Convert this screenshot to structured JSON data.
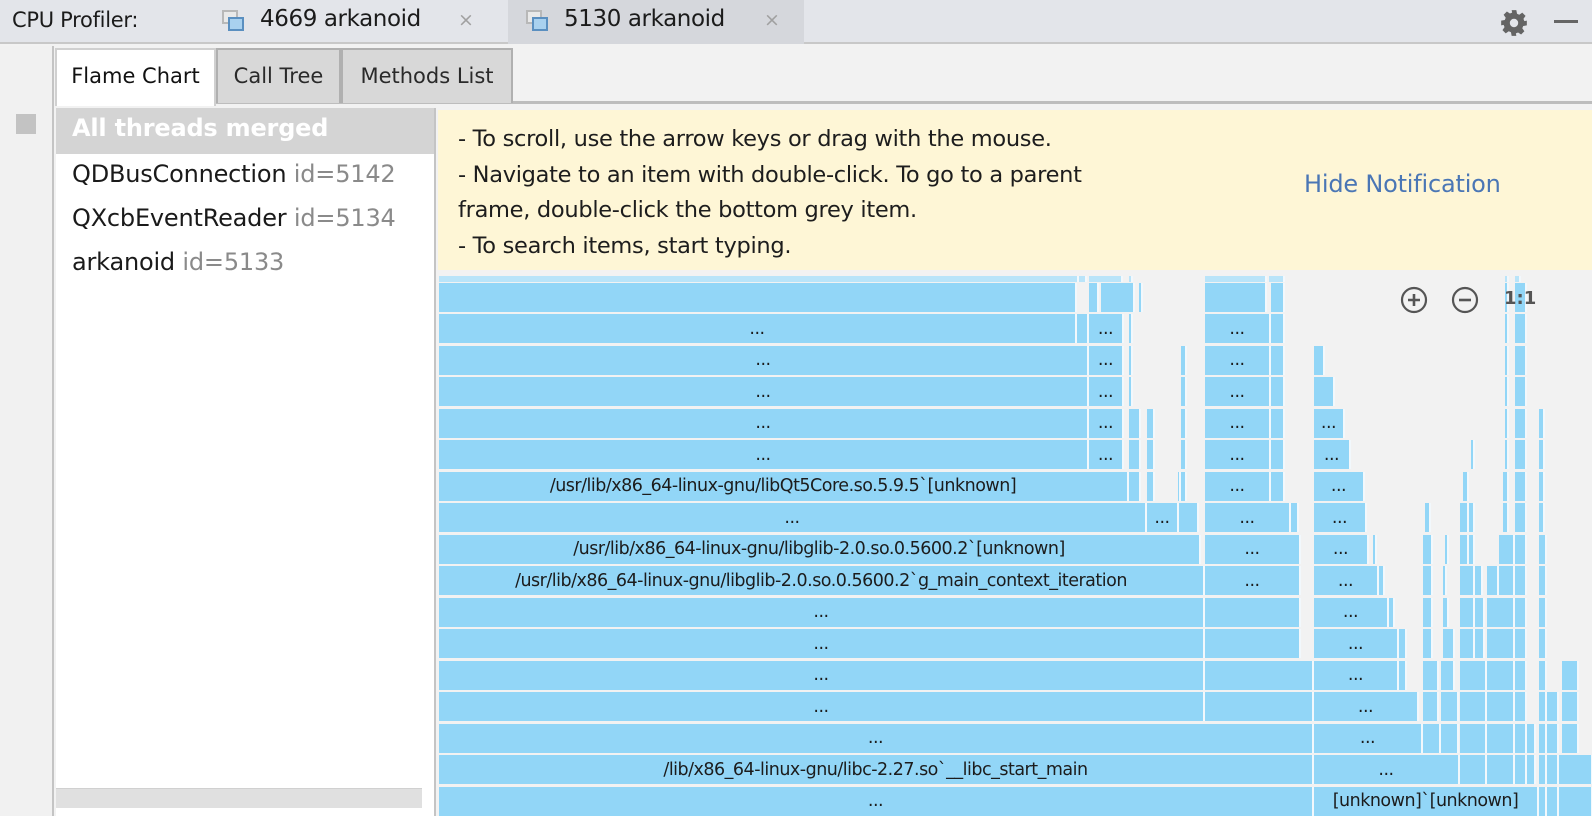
{
  "topbar": {
    "title": "CPU Profiler:",
    "sessions": [
      {
        "label": "4669 arkanoid",
        "close": "×",
        "active": false
      },
      {
        "label": "5130 arkanoid",
        "close": "×",
        "active": true
      }
    ],
    "icons": {
      "settings": "gear-icon",
      "minimize": "minimize-icon",
      "session": "window-icon",
      "close": "close-icon"
    }
  },
  "left_strip": {
    "icon": "stop-icon"
  },
  "view_tabs": [
    {
      "label": "Flame Chart",
      "active": true
    },
    {
      "label": "Call Tree",
      "active": false
    },
    {
      "label": "Methods List",
      "active": false
    }
  ],
  "threads": [
    {
      "name": "All threads merged",
      "id": "",
      "selected": true
    },
    {
      "name": "QDBusConnection",
      "id": "id=5142",
      "selected": false
    },
    {
      "name": "QXcbEventReader",
      "id": "id=5134",
      "selected": false
    },
    {
      "name": "arkanoid",
      "id": "id=5133",
      "selected": false
    }
  ],
  "notification": {
    "lines": [
      "- To scroll, use the arrow keys or drag with the mouse.",
      "- Navigate to an item with double-click. To go to a parent",
      "frame, double-click the bottom grey item.",
      "- To search items, start typing."
    ],
    "hide_label": "Hide Notification"
  },
  "zoom_controls": {
    "zoom_in": "zoom-in-icon",
    "zoom_out": "zoom-out-icon",
    "reset_label": "1:1"
  },
  "colors": {
    "frame": "#92d6f7",
    "frame_top": "#b9e4f9",
    "notice_bg": "#fef6d6",
    "link": "#4a76b5"
  },
  "flame": {
    "note": "rows listed from bottom (depth 0) upward; start/end in units of 1/1154 of visible chart width",
    "rows": [
      [
        [
          0,
          875,
          "..."
        ],
        [
          875,
          1100,
          "[unknown]`[unknown]"
        ],
        [
          1100,
          1108,
          ""
        ],
        [
          1108,
          1120,
          ""
        ],
        [
          1120,
          1154,
          ""
        ]
      ],
      [
        [
          0,
          875,
          "/lib/x86_64-linux-gnu/libc-2.27.so`__libc_start_main"
        ],
        [
          875,
          1021,
          "..."
        ],
        [
          1021,
          1048,
          ""
        ],
        [
          1048,
          1076,
          ""
        ],
        [
          1076,
          1088,
          ""
        ],
        [
          1088,
          1097,
          ""
        ],
        [
          1100,
          1108,
          ""
        ],
        [
          1108,
          1120,
          ""
        ],
        [
          1120,
          1154,
          ""
        ]
      ],
      [
        [
          0,
          875,
          "..."
        ],
        [
          875,
          984,
          "..."
        ],
        [
          984,
          1002,
          ""
        ],
        [
          1002,
          1020,
          ""
        ],
        [
          1021,
          1048,
          ""
        ],
        [
          1048,
          1076,
          ""
        ],
        [
          1076,
          1088,
          ""
        ],
        [
          1088,
          1097,
          ""
        ],
        [
          1100,
          1108,
          ""
        ],
        [
          1108,
          1120,
          ""
        ],
        [
          1123,
          1140,
          ""
        ]
      ],
      [
        [
          0,
          766,
          "..."
        ],
        [
          766,
          875,
          ""
        ],
        [
          875,
          980,
          "..."
        ],
        [
          984,
          1000,
          ""
        ],
        [
          1002,
          1020,
          ""
        ],
        [
          1021,
          1048,
          ""
        ],
        [
          1048,
          1076,
          ""
        ],
        [
          1076,
          1088,
          ""
        ],
        [
          1100,
          1108,
          ""
        ],
        [
          1108,
          1120,
          ""
        ],
        [
          1123,
          1140,
          ""
        ]
      ],
      [
        [
          0,
          766,
          "..."
        ],
        [
          766,
          875,
          ""
        ],
        [
          875,
          960,
          "..."
        ],
        [
          960,
          968,
          ""
        ],
        [
          984,
          1000,
          ""
        ],
        [
          1002,
          1016,
          ""
        ],
        [
          1021,
          1048,
          ""
        ],
        [
          1048,
          1076,
          ""
        ],
        [
          1076,
          1088,
          ""
        ],
        [
          1100,
          1108,
          ""
        ],
        [
          1123,
          1140,
          ""
        ]
      ],
      [
        [
          0,
          766,
          "..."
        ],
        [
          766,
          862,
          ""
        ],
        [
          875,
          960,
          "..."
        ],
        [
          960,
          968,
          ""
        ],
        [
          984,
          994,
          ""
        ],
        [
          1004,
          1016,
          ""
        ],
        [
          1021,
          1036,
          ""
        ],
        [
          1036,
          1046,
          ""
        ],
        [
          1048,
          1076,
          ""
        ],
        [
          1076,
          1088,
          ""
        ],
        [
          1100,
          1108,
          ""
        ]
      ],
      [
        [
          0,
          766,
          "..."
        ],
        [
          766,
          862,
          ""
        ],
        [
          875,
          950,
          "..."
        ],
        [
          950,
          956,
          ""
        ],
        [
          984,
          994,
          ""
        ],
        [
          1004,
          1010,
          ""
        ],
        [
          1021,
          1036,
          ""
        ],
        [
          1036,
          1046,
          ""
        ],
        [
          1048,
          1076,
          ""
        ],
        [
          1076,
          1088,
          ""
        ],
        [
          1100,
          1108,
          ""
        ]
      ],
      [
        [
          0,
          766,
          "/usr/lib/x86_64-linux-gnu/libglib-2.0.so.0.5600.2`g_main_context_iteration"
        ],
        [
          766,
          862,
          "..."
        ],
        [
          875,
          940,
          "..."
        ],
        [
          940,
          946,
          ""
        ],
        [
          984,
          994,
          ""
        ],
        [
          1004,
          1008,
          ""
        ],
        [
          1021,
          1036,
          ""
        ],
        [
          1036,
          1044,
          ""
        ],
        [
          1048,
          1060,
          ""
        ],
        [
          1060,
          1076,
          ""
        ],
        [
          1076,
          1088,
          ""
        ],
        [
          1100,
          1108,
          ""
        ]
      ],
      [
        [
          0,
          762,
          "/usr/lib/x86_64-linux-gnu/libglib-2.0.so.0.5600.2`[unknown]"
        ],
        [
          766,
          862,
          "..."
        ],
        [
          875,
          930,
          "..."
        ],
        [
          934,
          938,
          ""
        ],
        [
          984,
          994,
          ""
        ],
        [
          1006,
          1010,
          ""
        ],
        [
          1021,
          1030,
          ""
        ],
        [
          1030,
          1036,
          ""
        ],
        [
          1060,
          1076,
          ""
        ],
        [
          1076,
          1088,
          ""
        ],
        [
          1100,
          1108,
          ""
        ]
      ],
      [
        [
          0,
          708,
          "..."
        ],
        [
          708,
          740,
          "..."
        ],
        [
          740,
          760,
          ""
        ],
        [
          766,
          852,
          "..."
        ],
        [
          852,
          860,
          ""
        ],
        [
          875,
          928,
          "..."
        ],
        [
          986,
          992,
          ""
        ],
        [
          1021,
          1030,
          ""
        ],
        [
          1030,
          1036,
          ""
        ],
        [
          1064,
          1070,
          ""
        ],
        [
          1076,
          1088,
          ""
        ],
        [
          1100,
          1106,
          ""
        ]
      ],
      [
        [
          0,
          690,
          "/usr/lib/x86_64-linux-gnu/libQt5Core.so.5.9.5`[unknown]"
        ],
        [
          690,
          702,
          ""
        ],
        [
          708,
          716,
          ""
        ],
        [
          739,
          742,
          ""
        ],
        [
          742,
          748,
          ""
        ],
        [
          766,
          832,
          "..."
        ],
        [
          832,
          846,
          ""
        ],
        [
          875,
          926,
          "..."
        ],
        [
          1024,
          1030,
          ""
        ],
        [
          1064,
          1070,
          ""
        ],
        [
          1076,
          1088,
          ""
        ],
        [
          1100,
          1106,
          ""
        ]
      ],
      [
        [
          0,
          650,
          "..."
        ],
        [
          650,
          685,
          "..."
        ],
        [
          690,
          702,
          ""
        ],
        [
          708,
          716,
          ""
        ],
        [
          742,
          748,
          ""
        ],
        [
          766,
          832,
          "..."
        ],
        [
          832,
          846,
          ""
        ],
        [
          875,
          912,
          "..."
        ],
        [
          1032,
          1036,
          ""
        ],
        [
          1066,
          1070,
          ""
        ],
        [
          1076,
          1088,
          ""
        ],
        [
          1100,
          1106,
          ""
        ]
      ],
      [
        [
          0,
          650,
          "..."
        ],
        [
          650,
          685,
          "..."
        ],
        [
          690,
          702,
          ""
        ],
        [
          708,
          716,
          ""
        ],
        [
          742,
          748,
          ""
        ],
        [
          766,
          832,
          "..."
        ],
        [
          832,
          846,
          ""
        ],
        [
          875,
          906,
          "..."
        ],
        [
          1066,
          1070,
          ""
        ],
        [
          1076,
          1088,
          ""
        ],
        [
          1100,
          1106,
          ""
        ]
      ],
      [
        [
          0,
          650,
          "..."
        ],
        [
          650,
          685,
          "..."
        ],
        [
          690,
          694,
          ""
        ],
        [
          742,
          748,
          ""
        ],
        [
          766,
          832,
          "..."
        ],
        [
          832,
          846,
          ""
        ],
        [
          875,
          896,
          ""
        ],
        [
          1066,
          1070,
          ""
        ],
        [
          1076,
          1088,
          ""
        ]
      ],
      [
        [
          0,
          650,
          "..."
        ],
        [
          650,
          685,
          "..."
        ],
        [
          690,
          694,
          ""
        ],
        [
          742,
          748,
          ""
        ],
        [
          766,
          832,
          "..."
        ],
        [
          832,
          846,
          ""
        ],
        [
          875,
          886,
          ""
        ],
        [
          1066,
          1070,
          ""
        ],
        [
          1076,
          1088,
          ""
        ]
      ],
      [
        [
          0,
          638,
          "..."
        ],
        [
          638,
          650,
          ""
        ],
        [
          650,
          685,
          "..."
        ],
        [
          690,
          694,
          ""
        ],
        [
          766,
          832,
          "..."
        ],
        [
          832,
          846,
          ""
        ],
        [
          1066,
          1070,
          ""
        ],
        [
          1076,
          1088,
          ""
        ]
      ],
      [
        [
          0,
          638,
          ""
        ],
        [
          650,
          660,
          ""
        ],
        [
          662,
          696,
          ""
        ],
        [
          700,
          704,
          ""
        ],
        [
          766,
          828,
          ""
        ],
        [
          832,
          846,
          ""
        ],
        [
          1066,
          1070,
          ""
        ],
        [
          1076,
          1088,
          ""
        ]
      ]
    ]
  }
}
